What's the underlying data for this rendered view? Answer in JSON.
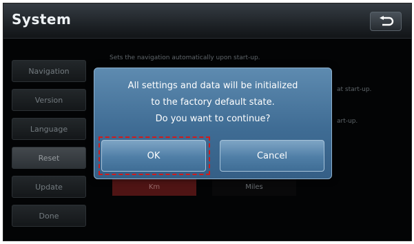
{
  "header": {
    "title": "System",
    "back_icon": "back-arrow-icon"
  },
  "sidebar": {
    "items": [
      {
        "label": "Navigation",
        "active": false
      },
      {
        "label": "Version",
        "active": false
      },
      {
        "label": "Language",
        "active": false
      },
      {
        "label": "Reset",
        "active": true
      },
      {
        "label": "Update",
        "active": false
      },
      {
        "label": "Done",
        "active": false
      }
    ]
  },
  "content": {
    "line1": "Sets the navigation automatically upon start-up.",
    "line2_fragment": "at start-up.",
    "line3_fragment": "art-up.",
    "unit_options": [
      "Km",
      "Miles"
    ],
    "selected_unit": "Km"
  },
  "dialog": {
    "message_lines": [
      "All settings and data will be initialized",
      "to the factory default state.",
      "Do you want to continue?"
    ],
    "ok_label": "OK",
    "cancel_label": "Cancel"
  },
  "colors": {
    "dialog_blue": "#4a78a0",
    "highlight_red": "#d21a1a",
    "selected_unit_red": "#6a1b1b"
  }
}
